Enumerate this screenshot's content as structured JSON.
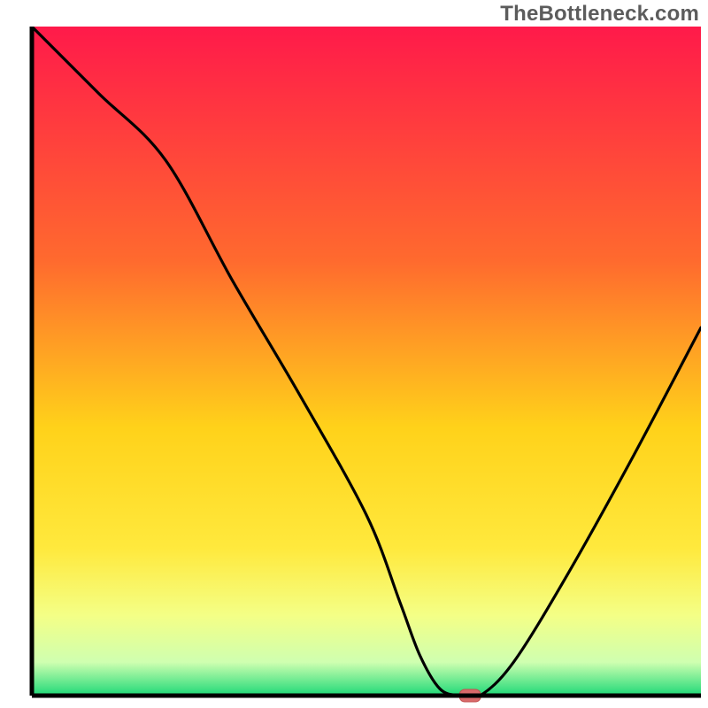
{
  "watermark": "TheBottleneck.com",
  "chart_data": {
    "type": "line",
    "title": "",
    "xlabel": "",
    "ylabel": "",
    "xlim": [
      0,
      100
    ],
    "ylim": [
      0,
      100
    ],
    "x": [
      0,
      10,
      20,
      30,
      40,
      50,
      55,
      58,
      61,
      64,
      67,
      72,
      80,
      90,
      100
    ],
    "values": [
      100,
      90,
      80,
      62,
      45,
      27,
      14,
      6,
      1,
      0,
      0,
      5,
      18,
      36,
      55
    ],
    "marker": {
      "x": 65.5,
      "y": 0
    },
    "gradient_stops": [
      {
        "pct": 0,
        "color": "#ff1a4a"
      },
      {
        "pct": 35,
        "color": "#ff6a2e"
      },
      {
        "pct": 60,
        "color": "#ffd21a"
      },
      {
        "pct": 78,
        "color": "#ffe93d"
      },
      {
        "pct": 88,
        "color": "#f4ff86"
      },
      {
        "pct": 95,
        "color": "#cfffb0"
      },
      {
        "pct": 100,
        "color": "#1ed978"
      }
    ],
    "colors": {
      "axis": "#000000",
      "curve": "#000000",
      "marker_fill": "#d96a6a",
      "marker_stroke": "#c44f4f"
    }
  }
}
